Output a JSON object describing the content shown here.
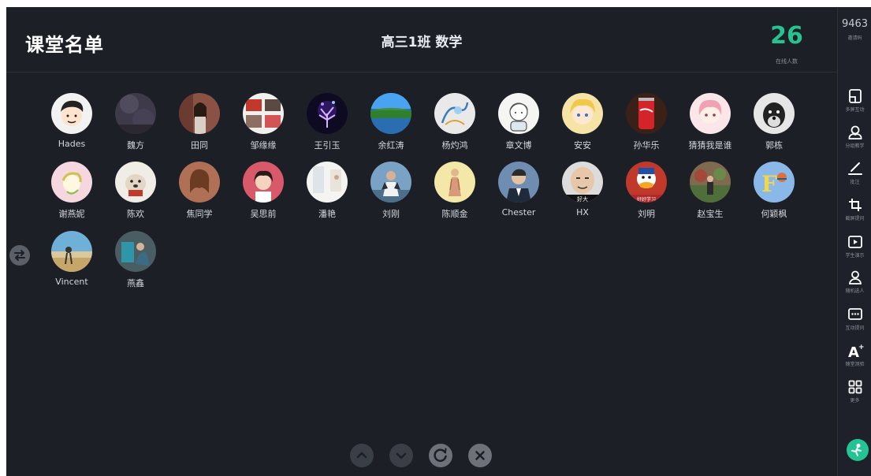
{
  "header": {
    "page_title": "课堂名单",
    "class_name": "高三1班  数学",
    "online_count": "26",
    "online_label": "在线人数"
  },
  "students": [
    {
      "name": "Hades",
      "avatar": "cartoon-boy"
    },
    {
      "name": "魏方",
      "avatar": "night-sky"
    },
    {
      "name": "田同",
      "avatar": "girl-photo"
    },
    {
      "name": "邹缘缘",
      "avatar": "collage"
    },
    {
      "name": "王引玉",
      "avatar": "neon-tree"
    },
    {
      "name": "余红涛",
      "avatar": "lake-landscape"
    },
    {
      "name": "杨灼鸿",
      "avatar": "sketch-art"
    },
    {
      "name": "章文博",
      "avatar": "cartoon-child"
    },
    {
      "name": "安安",
      "avatar": "anime-girl"
    },
    {
      "name": "孙华乐",
      "avatar": "cola-can"
    },
    {
      "name": "猜猜我是谁",
      "avatar": "pink-anime"
    },
    {
      "name": "郭栋",
      "avatar": "schnauzer-dog"
    },
    {
      "name": "谢燕妮",
      "avatar": "cartoon-pink"
    },
    {
      "name": "陈欢",
      "avatar": "bulldog"
    },
    {
      "name": "焦同学",
      "avatar": "woman-photo"
    },
    {
      "name": "吴思前",
      "avatar": "girl-selfie"
    },
    {
      "name": "潘艳",
      "avatar": "white-room"
    },
    {
      "name": "刘刚",
      "avatar": "man-suit"
    },
    {
      "name": "陈顺金",
      "avatar": "painting-figure"
    },
    {
      "name": "Chester",
      "avatar": "man-portrait"
    },
    {
      "name": "HX",
      "avatar": "meme-face"
    },
    {
      "name": "刘明",
      "avatar": "donald-duck"
    },
    {
      "name": "赵宝生",
      "avatar": "man-garden"
    },
    {
      "name": "何颖枫",
      "avatar": "letter-f"
    },
    {
      "name": "Vincent",
      "avatar": "beach-sunset"
    },
    {
      "name": "燕鑫",
      "avatar": "person-blue"
    }
  ],
  "rail": {
    "invite_code": "9463",
    "invite_label": "邀请码",
    "tools": [
      {
        "label": "多屏互动",
        "icon": "multi-screen-icon"
      },
      {
        "label": "分组教学",
        "icon": "group-teaching-icon"
      },
      {
        "label": "批注",
        "icon": "annotate-pen-icon"
      },
      {
        "label": "截屏提问",
        "icon": "crop-icon"
      },
      {
        "label": "学生演示",
        "icon": "play-screen-icon"
      },
      {
        "label": "随机选人",
        "icon": "random-person-icon"
      },
      {
        "label": "互动提问",
        "icon": "chat-question-icon"
      },
      {
        "label": "随堂测验",
        "icon": "quiz-a-plus-icon"
      },
      {
        "label": "更多",
        "icon": "more-grid-icon"
      }
    ]
  },
  "bottom_controls": [
    "page-up-icon",
    "page-down-icon",
    "refresh-icon",
    "close-icon"
  ],
  "colors": {
    "background": "#1c1f26",
    "accent_green": "#27c28f",
    "text_light": "#d3d7de"
  }
}
